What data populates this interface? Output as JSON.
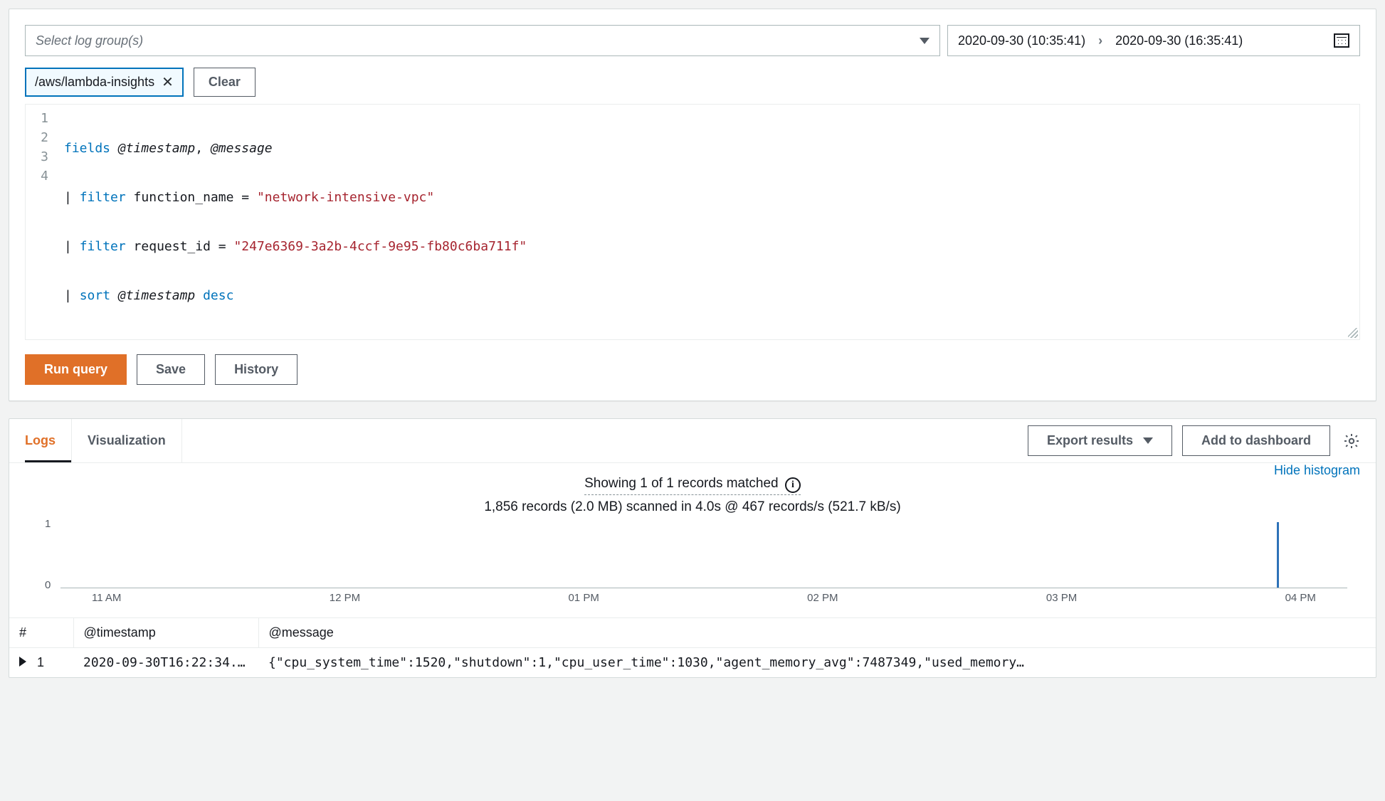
{
  "log_group_select": {
    "placeholder": "Select log group(s)"
  },
  "time_range": {
    "from": "2020-09-30 (10:35:41)",
    "to": "2020-09-30 (16:35:41)"
  },
  "chip": {
    "label": "/aws/lambda-insights"
  },
  "clear_label": "Clear",
  "editor": {
    "lines": [
      "1",
      "2",
      "3",
      "4"
    ],
    "l1_kw": "fields",
    "l1_f1": "@timestamp",
    "l1_comma": ", ",
    "l1_f2": "@message",
    "l2_pipe": "| ",
    "l2_kw": "filter",
    "l2_field": " function_name ",
    "l2_eq": "= ",
    "l2_str": "\"network-intensive-vpc\"",
    "l3_pipe": "| ",
    "l3_kw": "filter",
    "l3_field": " request_id ",
    "l3_eq": "= ",
    "l3_str": "\"247e6369-3a2b-4ccf-9e95-fb80c6ba711f\"",
    "l4_pipe": "| ",
    "l4_kw": "sort",
    "l4_field": " @timestamp ",
    "l4_dir": "desc"
  },
  "actions": {
    "run": "Run query",
    "save": "Save",
    "history": "History"
  },
  "tabs": {
    "logs": "Logs",
    "viz": "Visualization"
  },
  "results_actions": {
    "export": "Export results",
    "add": "Add to dashboard"
  },
  "summary": {
    "line1": "Showing 1 of 1 records matched",
    "line2": "1,856 records (2.0 MB) scanned in 4.0s @ 467 records/s (521.7 kB/s)",
    "hide": "Hide histogram"
  },
  "hist": {
    "y1": "1",
    "y0": "0",
    "ticks": [
      "11 AM",
      "12 PM",
      "01 PM",
      "02 PM",
      "03 PM",
      "04 PM"
    ]
  },
  "table": {
    "headers": {
      "idx": "#",
      "ts": "@timestamp",
      "msg": "@message"
    },
    "row": {
      "idx": "1",
      "ts": "2020-09-30T16:22:34.…",
      "msg": "{\"cpu_system_time\":1520,\"shutdown\":1,\"cpu_user_time\":1030,\"agent_memory_avg\":7487349,\"used_memory…"
    }
  },
  "chart_data": {
    "type": "bar",
    "title": "",
    "xlabel": "",
    "ylabel": "",
    "ylim": [
      0,
      1
    ],
    "categories": [
      "11 AM",
      "12 PM",
      "01 PM",
      "02 PM",
      "03 PM",
      "04 PM"
    ],
    "series": [
      {
        "name": "records",
        "values": [
          0,
          0,
          0,
          0,
          0,
          1
        ]
      }
    ],
    "note": "single matched record appears slightly after 04 PM"
  }
}
